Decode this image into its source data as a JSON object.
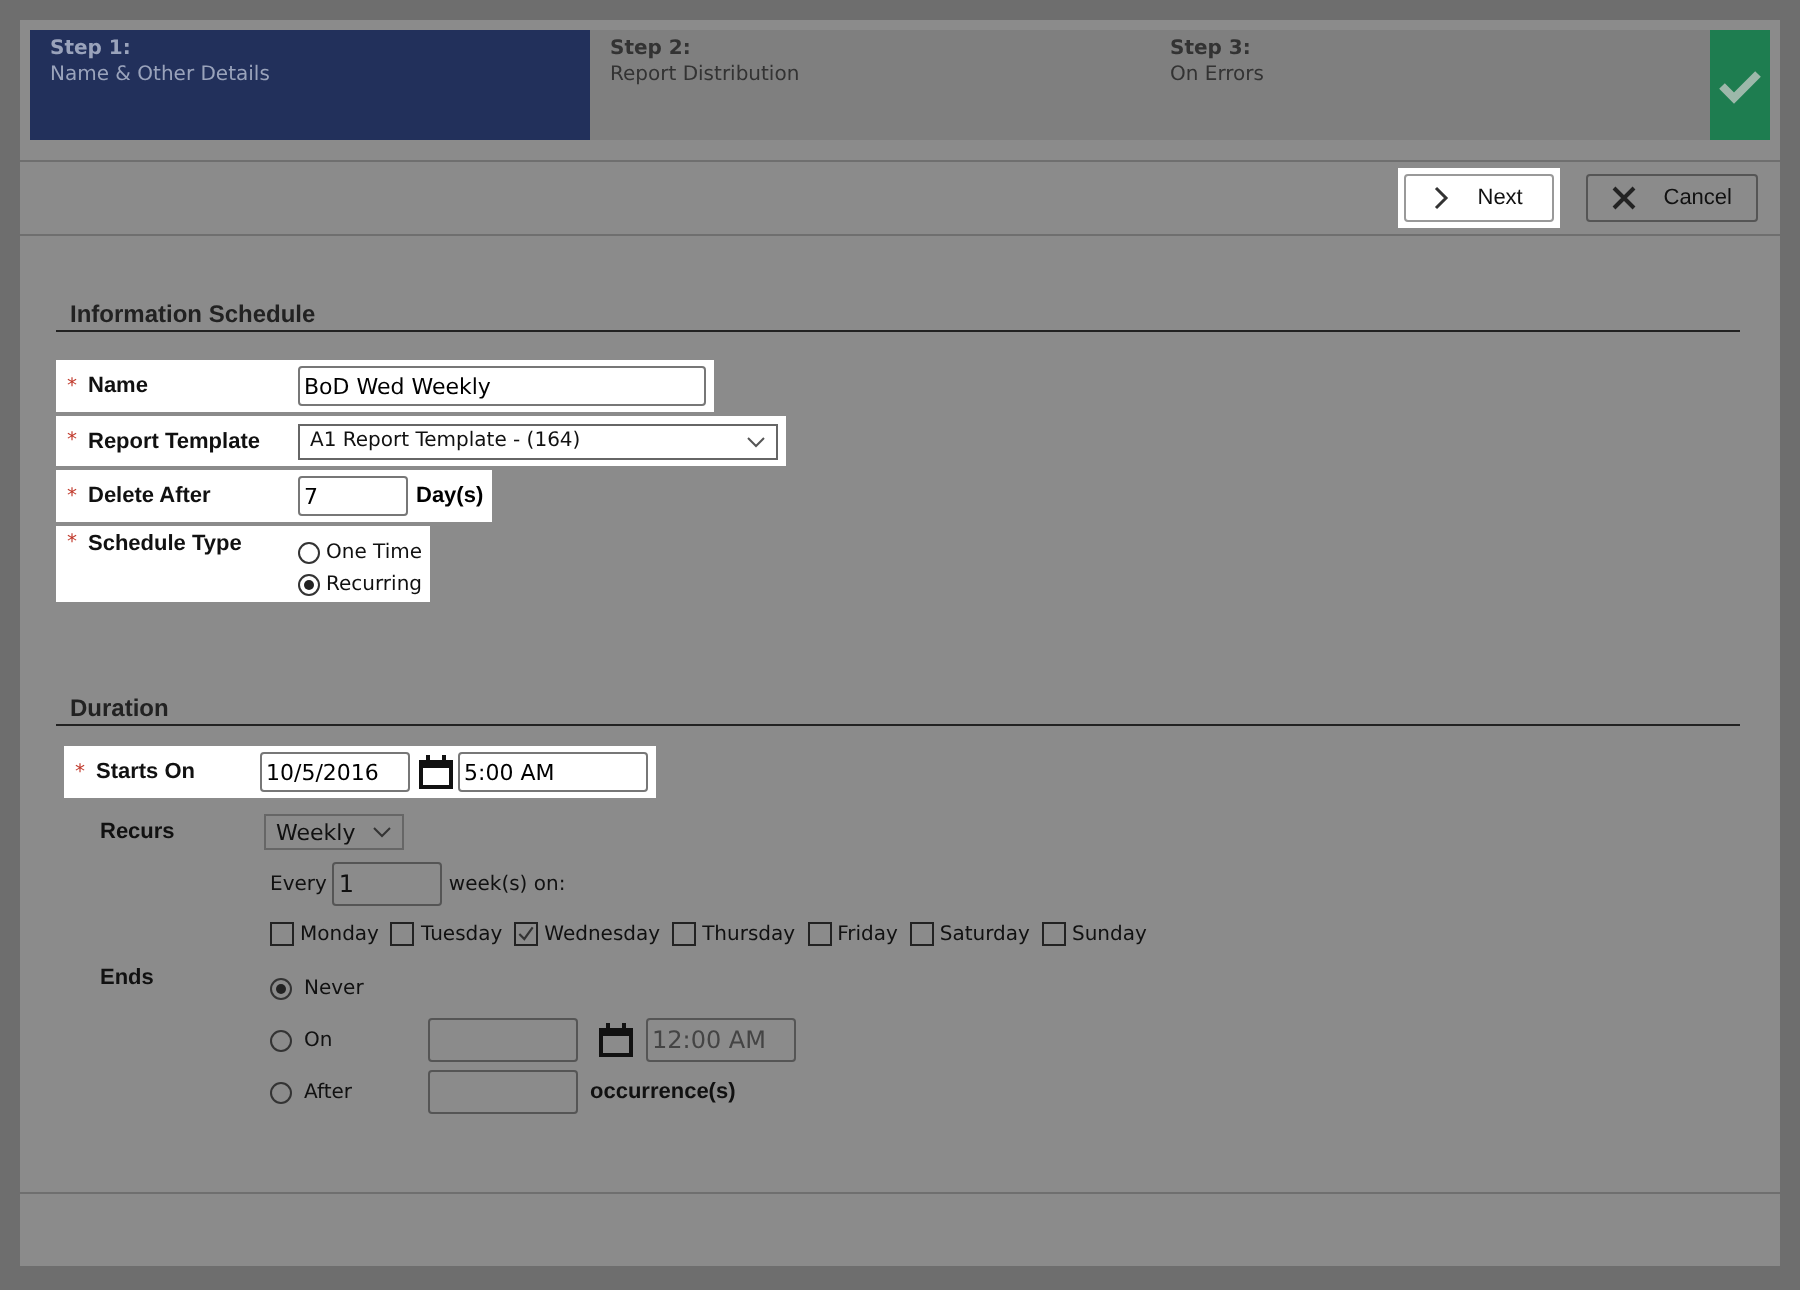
{
  "steps": [
    {
      "number": "Step 1:",
      "label": "Name & Other Details",
      "selected": true
    },
    {
      "number": "Step 2:",
      "label": "Report Distribution",
      "selected": false
    },
    {
      "number": "Step 3:",
      "label": "On Errors",
      "selected": false
    }
  ],
  "toolbar": [
    {
      "label": "Next",
      "kind": "next",
      "highlighted": true
    },
    {
      "label": "Cancel",
      "kind": "cancel",
      "highlighted": false
    }
  ],
  "information_schedule": {
    "title": "Information Schedule",
    "fields": [
      {
        "kind": "text",
        "required": "*",
        "label": "Name",
        "value": "BoD Wed Weekly",
        "highlighted": true
      },
      {
        "kind": "select",
        "required": "*",
        "label": "Report Template",
        "value": "A1 Report Template - (164)",
        "highlighted": true
      },
      {
        "kind": "number",
        "required": "*",
        "label": "Delete After",
        "value": "7",
        "suffix": "Day(s)",
        "highlighted": true
      },
      {
        "kind": "radio",
        "required": "*",
        "label": "Schedule Type",
        "highlighted": true,
        "options": [
          {
            "label": "One Time",
            "selected": false
          },
          {
            "label": "Recurring",
            "selected": true
          }
        ]
      }
    ]
  },
  "duration": {
    "title": "Duration",
    "starts_on": {
      "required": "*",
      "label": "Starts On",
      "date": "10/5/2016",
      "time": "5:00 AM",
      "highlighted": true
    },
    "recurs": {
      "label": "Recurs",
      "value": "Weekly"
    },
    "every": {
      "prefix": "Every",
      "value": "1",
      "suffix": "week(s) on:"
    },
    "days": [
      {
        "label": "Monday",
        "checked": false
      },
      {
        "label": "Tuesday",
        "checked": false
      },
      {
        "label": "Wednesday",
        "checked": true
      },
      {
        "label": "Thursday",
        "checked": false
      },
      {
        "label": "Friday",
        "checked": false
      },
      {
        "label": "Saturday",
        "checked": false
      },
      {
        "label": "Sunday",
        "checked": false
      }
    ],
    "ends": {
      "label": "Ends",
      "options": [
        {
          "kind": "never",
          "label": "Never",
          "selected": true
        },
        {
          "kind": "on",
          "label": "On",
          "selected": false,
          "time": "12:00 AM"
        },
        {
          "kind": "after",
          "label": "After",
          "selected": false,
          "suffix": "occurrence(s)"
        }
      ]
    }
  }
}
